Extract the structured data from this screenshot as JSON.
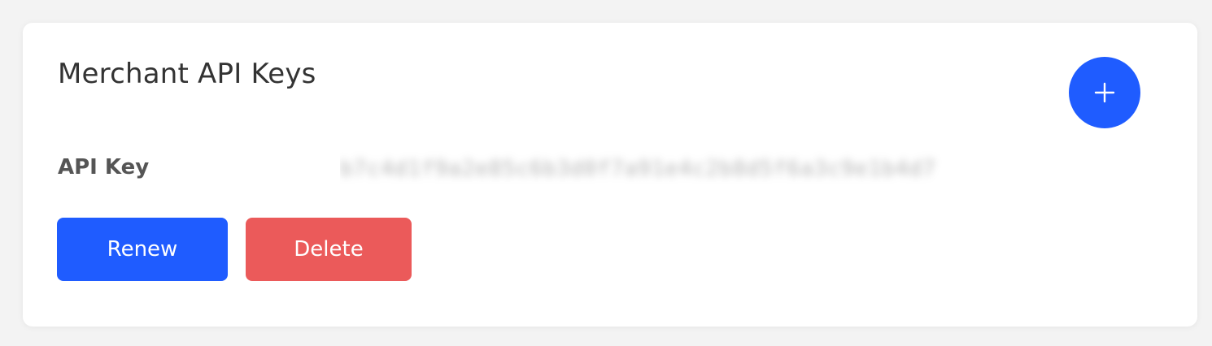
{
  "card": {
    "title": "Merchant API Keys",
    "add_button_icon": "plus-icon"
  },
  "api_key": {
    "label": "API Key",
    "value": "b7c4d1f9a2e85c6b3d0f7a91e4c2b8d5f6a3c9e1b4d7"
  },
  "actions": {
    "renew_label": "Renew",
    "delete_label": "Delete"
  },
  "colors": {
    "primary": "#1f5cff",
    "danger": "#eb5a5a",
    "page_background": "#f3f3f3",
    "card_background": "#ffffff"
  }
}
